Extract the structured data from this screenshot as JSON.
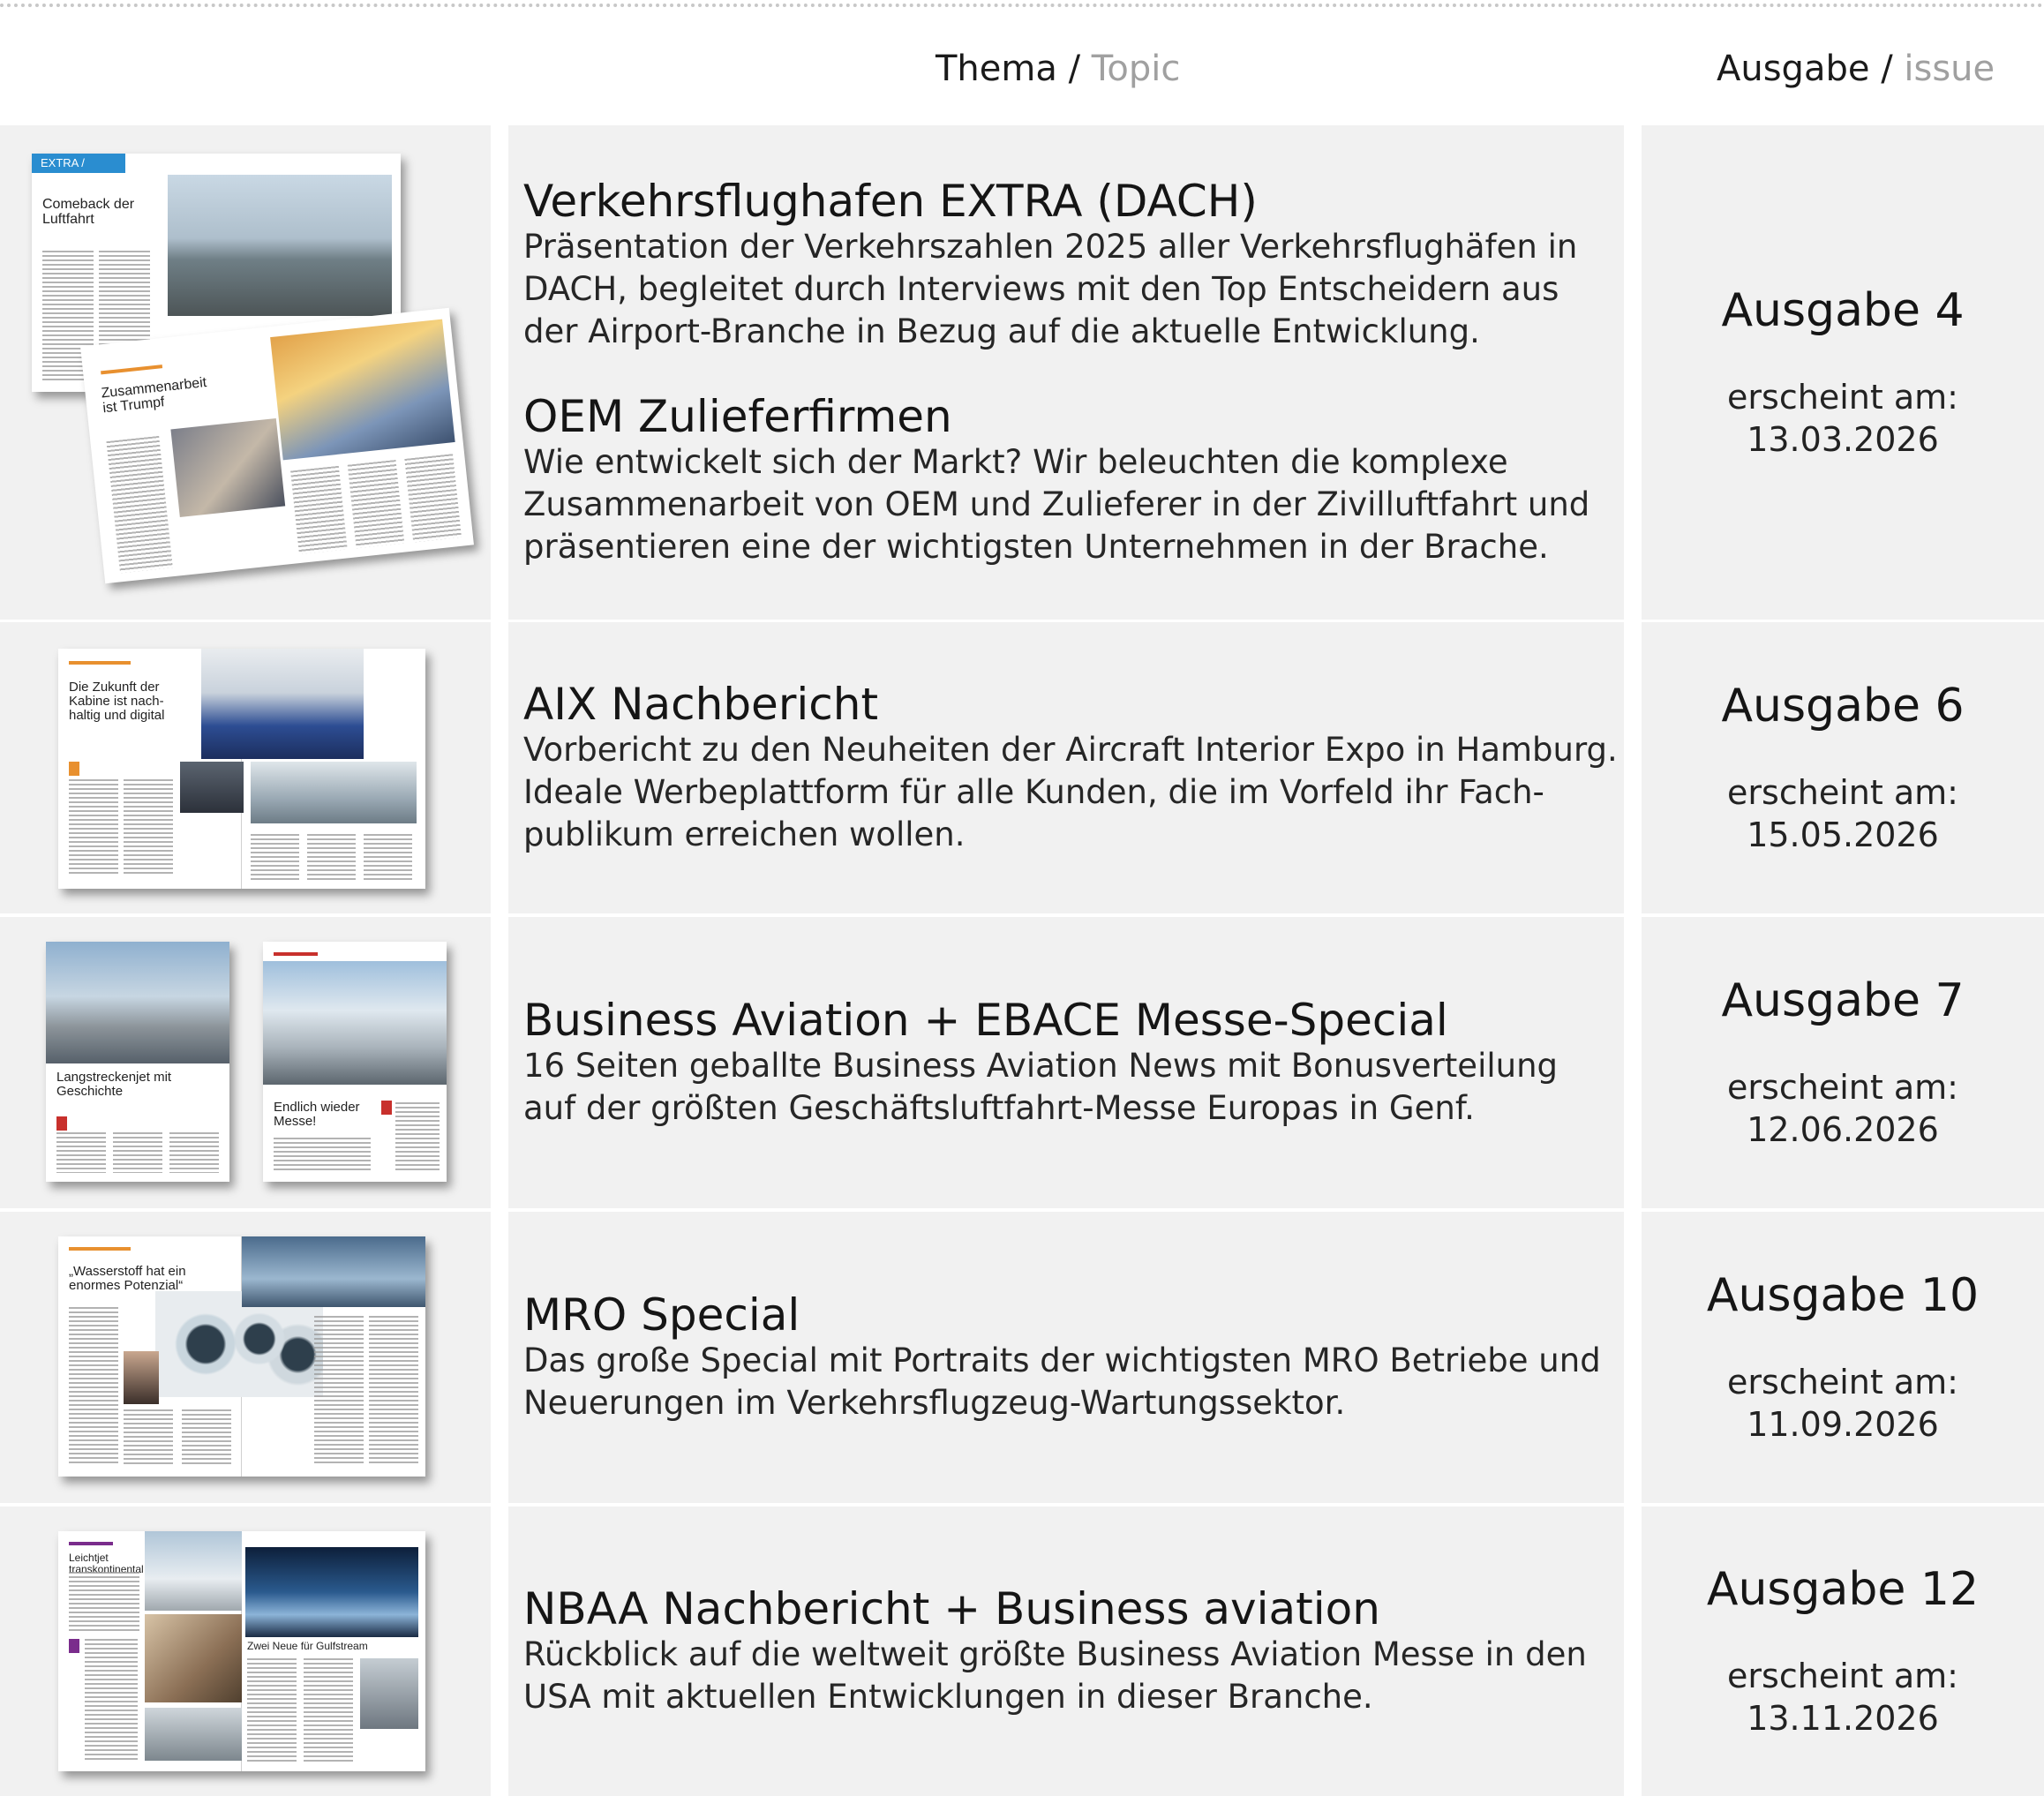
{
  "header": {
    "thema": "Thema",
    "topic": "Topic",
    "ausgabe": "Ausgabe",
    "issue": "issue",
    "separator": "/"
  },
  "rows": [
    {
      "topics": [
        {
          "title": "Verkehrsflughafen EXTRA (DACH)",
          "description": "Präsentation der Verkehrszahlen 2025 aller Verkehrsflughäfen in DACH, begleitet durch Interviews mit den Top Entscheidern aus der Airport-Branche in Bezug auf die aktuelle Entwicklung."
        },
        {
          "title": "OEM Zulieferfirmen",
          "description": "Wie entwickelt sich der Markt? Wir beleuchten die komplexe Zusammenarbeit von OEM und Zulieferer in der Zivilluftfahrt und präsentieren eine der wichtigsten Unternehmen in der Brache."
        }
      ],
      "issue": "Ausgabe 4",
      "label": "erscheint am:",
      "date": "13.03.2026",
      "thumb": {
        "headline_a": "Comeback der Luftfahrt",
        "headline_b": "Zusammenarbeit ist Trumpf",
        "tab": "EXTRA /"
      }
    },
    {
      "topics": [
        {
          "title": "AIX Nachbericht",
          "description": "Vorbericht zu den Neuheiten der Aircraft Interior Expo in Hamburg. Ideale Werbeplattform für alle Kunden, die im Vorfeld ihr Fach-publikum erreichen wollen."
        }
      ],
      "issue": "Ausgabe 6",
      "label": "erscheint am:",
      "date": "15.05.2026",
      "thumb": {
        "headline_a": "Die Zukunft der Kabine ist nach-haltig und digital"
      }
    },
    {
      "topics": [
        {
          "title": "Business Aviation + EBACE Messe-Special",
          "description": "16 Seiten geballte Business Aviation News mit Bonusverteilung auf der größten Geschäftsluftfahrt-Messe Europas in Genf."
        }
      ],
      "issue": "Ausgabe 7",
      "label": "erscheint am:",
      "date": "12.06.2026",
      "thumb": {
        "headline_a": "Langstreckenjet mit Geschichte",
        "headline_b": "Endlich wieder Messe!"
      }
    },
    {
      "topics": [
        {
          "title": "MRO Special",
          "description": "Das große Special mit Portraits der wichtigsten MRO Betriebe und Neuerungen im Verkehrsflugzeug-Wartungssektor."
        }
      ],
      "issue": "Ausgabe 10",
      "label": "erscheint am:",
      "date": "11.09.2026",
      "thumb": {
        "headline_a": "„Wasserstoff hat ein enormes Potenzial“"
      }
    },
    {
      "topics": [
        {
          "title": "NBAA Nachbericht + Business aviation",
          "description": "Rückblick auf die weltweit größte Business Aviation Messe in den USA mit aktuellen Entwicklungen in dieser Branche."
        }
      ],
      "issue": "Ausgabe 12",
      "label": "erscheint am:",
      "date": "13.11.2026",
      "thumb": {
        "headline_a": "Leichtjet transkontinental",
        "headline_b": "Zwei Neue für Gulfstream"
      }
    }
  ],
  "colors": {
    "cell_bg": "#f1f1f1",
    "muted": "#a0a0a0",
    "extra_tab": "#2a8dd0",
    "accent_orange": "#e8902f"
  }
}
